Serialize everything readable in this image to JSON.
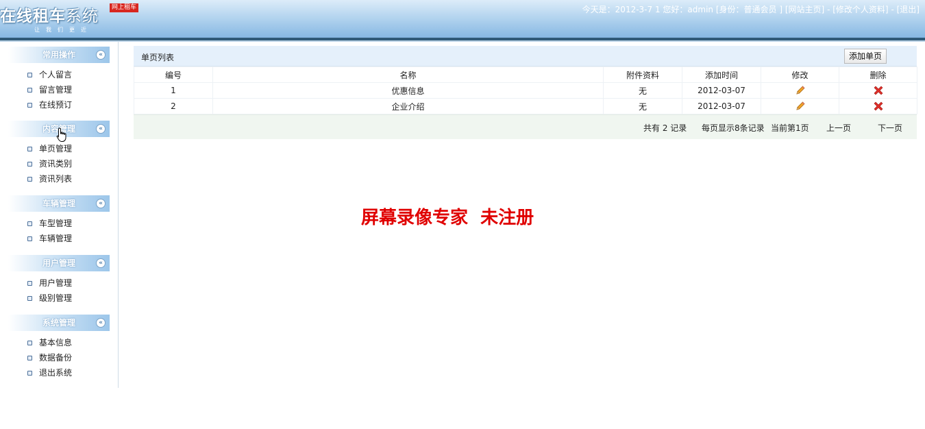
{
  "header": {
    "logo_main": "在线租车",
    "logo_thin": "系统",
    "badge": "网上租车",
    "slogan": "让我们更近",
    "date_text": "今天是：2012-3-7 1",
    "greeting": "您好：admin",
    "role": "[身份：普通会员 ]",
    "link_home": "[网站主页]",
    "sep": "-",
    "link_profile": "[修改个人资料]",
    "link_logout": "[退出]"
  },
  "sidebar": {
    "groups": [
      {
        "title": "常用操作",
        "items": [
          "个人留言",
          "留言管理",
          "在线预订"
        ]
      },
      {
        "title": "内容管理",
        "items": [
          "单页管理",
          "资讯类别",
          "资讯列表"
        ]
      },
      {
        "title": "车辆管理",
        "items": [
          "车型管理",
          "车辆管理"
        ]
      },
      {
        "title": "用户管理",
        "items": [
          "用户管理",
          "级别管理"
        ]
      },
      {
        "title": "系统管理",
        "items": [
          "基本信息",
          "数据备份",
          "退出系统"
        ]
      }
    ],
    "collapse_glyph": "«"
  },
  "main": {
    "title": "单页列表",
    "add_label": "添加单页",
    "columns": [
      "编号",
      "名称",
      "附件资料",
      "添加时间",
      "修改",
      "删除"
    ],
    "rows": [
      {
        "id": "1",
        "name": "优惠信息",
        "attach": "无",
        "date": "2012-03-07"
      },
      {
        "id": "2",
        "name": "企业介绍",
        "attach": "无",
        "date": "2012-03-07"
      }
    ],
    "pager": {
      "total": "共有 2 记录",
      "per_page": "每页显示8条记录",
      "current": "当前第1页",
      "prev": "上一页",
      "next": "下一页"
    }
  },
  "watermark": "屏幕录像专家  未注册",
  "colors": {
    "accent": "#86b8e3",
    "delete": "#d8261f",
    "edit": "#f0a020",
    "watermark": "#e00000"
  },
  "icons": {
    "edit": "pencil-icon",
    "delete": "delete-x-icon",
    "collapse": "collapse-icon"
  }
}
